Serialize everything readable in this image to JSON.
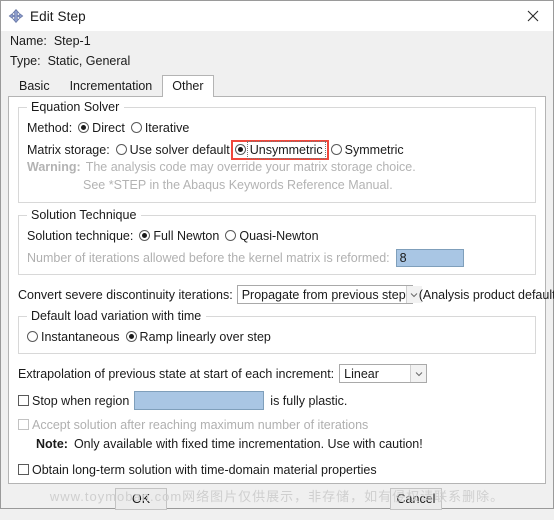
{
  "window": {
    "title": "Edit Step",
    "icon": "edit-step-diamond-icon",
    "close_label": "×"
  },
  "header": {
    "name_label": "Name:",
    "name_value": "Step-1",
    "type_label": "Type:",
    "type_value": "Static, General"
  },
  "tabs": [
    {
      "label": "Basic",
      "active": false
    },
    {
      "label": "Incrementation",
      "active": false
    },
    {
      "label": "Other",
      "active": true
    }
  ],
  "equation_solver": {
    "title": "Equation Solver",
    "method_label": "Method:",
    "method_options": [
      {
        "label": "Direct",
        "selected": true
      },
      {
        "label": "Iterative",
        "selected": false
      }
    ],
    "matrix_label": "Matrix storage:",
    "matrix_options": [
      {
        "label": "Use solver default",
        "selected": false,
        "highlighted": false
      },
      {
        "label": "Unsymmetric",
        "selected": true,
        "highlighted": true
      },
      {
        "label": "Symmetric",
        "selected": false,
        "highlighted": false
      }
    ],
    "warning_key": "Warning:",
    "warning_line1": "The analysis code may override your matrix storage choice.",
    "warning_line2": "See *STEP in the Abaqus Keywords Reference Manual."
  },
  "solution_technique": {
    "title": "Solution Technique",
    "technique_label": "Solution technique:",
    "technique_options": [
      {
        "label": "Full Newton",
        "selected": true
      },
      {
        "label": "Quasi-Newton",
        "selected": false
      }
    ],
    "kernel_label": "Number of iterations allowed before the kernel matrix is reformed:",
    "kernel_value": "8"
  },
  "convert": {
    "label": "Convert severe discontinuity iterations:",
    "value": "Propagate from previous step",
    "suffix": "(Analysis product default)"
  },
  "load_variation": {
    "title": "Default load variation with time",
    "options": [
      {
        "label": "Instantaneous",
        "selected": false
      },
      {
        "label": "Ramp linearly over step",
        "selected": true
      }
    ]
  },
  "extrapolation": {
    "label": "Extrapolation of previous state at start of each increment:",
    "value": "Linear"
  },
  "stop_region": {
    "checked": false,
    "label_before": "Stop when region",
    "field_value": "",
    "label_after": "is fully plastic."
  },
  "accept_solution": {
    "checked": false,
    "disabled": true,
    "label": "Accept solution after reaching maximum number of iterations"
  },
  "note": {
    "key": "Note:",
    "text": "Only available with fixed time incrementation. Use with caution!"
  },
  "long_term": {
    "checked": false,
    "label": "Obtain long-term solution with time-domain material properties"
  },
  "buttons": {
    "ok": "OK",
    "cancel": "Cancel"
  },
  "watermark": "www.toymoban.com网络图片仅供展示，非存储，如有侵权请联系删除。",
  "colors": {
    "highlight_box": "#f0473c",
    "field_fill": "#a9c6e4",
    "accent_icon": "#7b8cc0"
  }
}
